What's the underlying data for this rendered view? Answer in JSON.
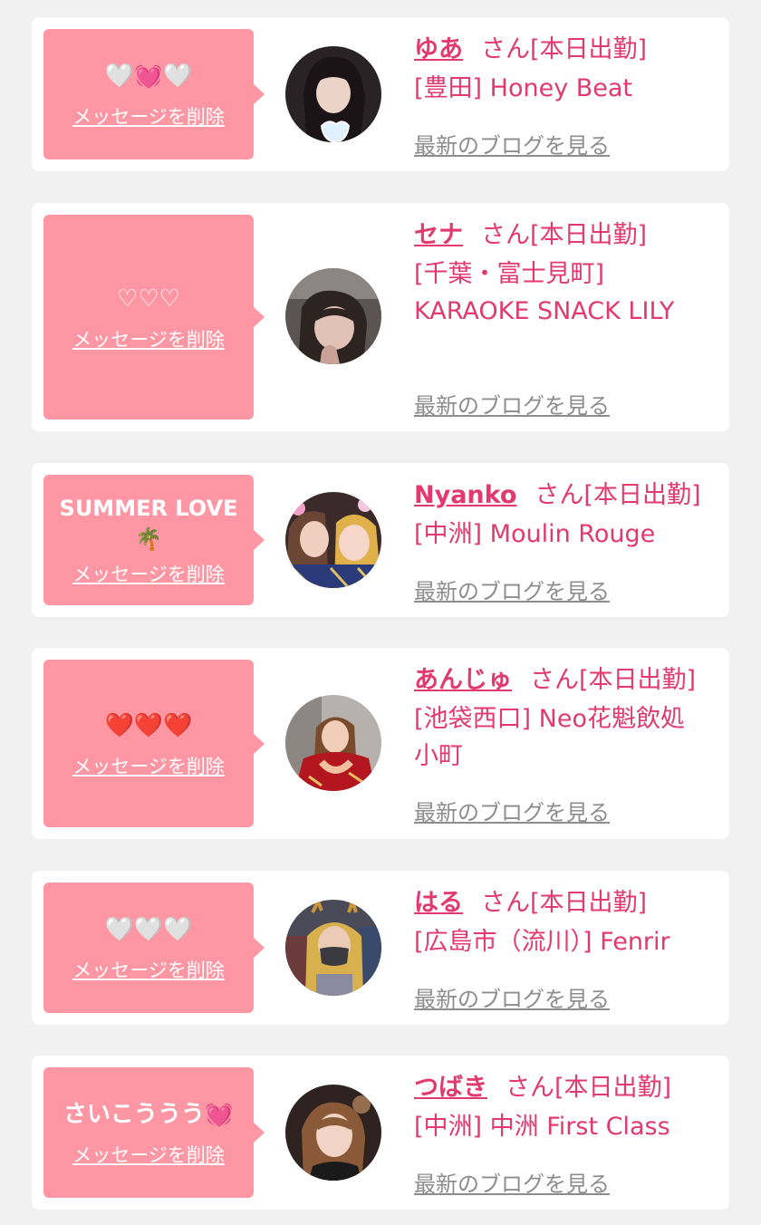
{
  "colors": {
    "page_bg": "#f1f1f1",
    "card_bg": "#ffffff",
    "bubble_bg": "#fe96a4",
    "accent_pink": "#e23a6f",
    "muted_gray": "#8d8d8d"
  },
  "cards": [
    {
      "message": "🤍💓🤍",
      "delete_label": "メッセージを削除",
      "name": "ゆあ",
      "honorific": "さん",
      "status": "[本日出勤]",
      "shop": "[豊田] Honey Beat",
      "blog_label": "最新のブログを見る",
      "avatar_icon": "profile-photo"
    },
    {
      "message": "♡♡♡",
      "delete_label": "メッセージを削除",
      "name": "セナ",
      "honorific": "さん",
      "status": "[本日出勤]",
      "shop": "[千葉・富士見町] KARAOKE SNACK LILY",
      "blog_label": "最新のブログを見る",
      "avatar_icon": "profile-photo"
    },
    {
      "message": "SUMMER LOVE 🌴",
      "delete_label": "メッセージを削除",
      "name": "Nyanko",
      "honorific": "さん",
      "status": "[本日出勤]",
      "shop": "[中洲] Moulin Rouge",
      "blog_label": "最新のブログを見る",
      "avatar_icon": "profile-photo"
    },
    {
      "message": "❤️❤️❤️",
      "delete_label": "メッセージを削除",
      "name": "あんじゅ",
      "honorific": "さん",
      "status": "[本日出勤]",
      "shop": "[池袋西口] Neo花魁飲処小町",
      "blog_label": "最新のブログを見る",
      "avatar_icon": "profile-photo"
    },
    {
      "message": "🤍🤍🤍",
      "delete_label": "メッセージを削除",
      "name": "はる",
      "honorific": "さん",
      "status": "[本日出勤]",
      "shop": "[広島市（流川）] Fenrir",
      "blog_label": "最新のブログを見る",
      "avatar_icon": "profile-photo"
    },
    {
      "message": "さいこううう💓",
      "delete_label": "メッセージを削除",
      "name": "つばき",
      "honorific": "さん",
      "status": "[本日出勤]",
      "shop": "[中洲] 中洲 First Class",
      "blog_label": "最新のブログを見る",
      "avatar_icon": "profile-photo"
    }
  ]
}
